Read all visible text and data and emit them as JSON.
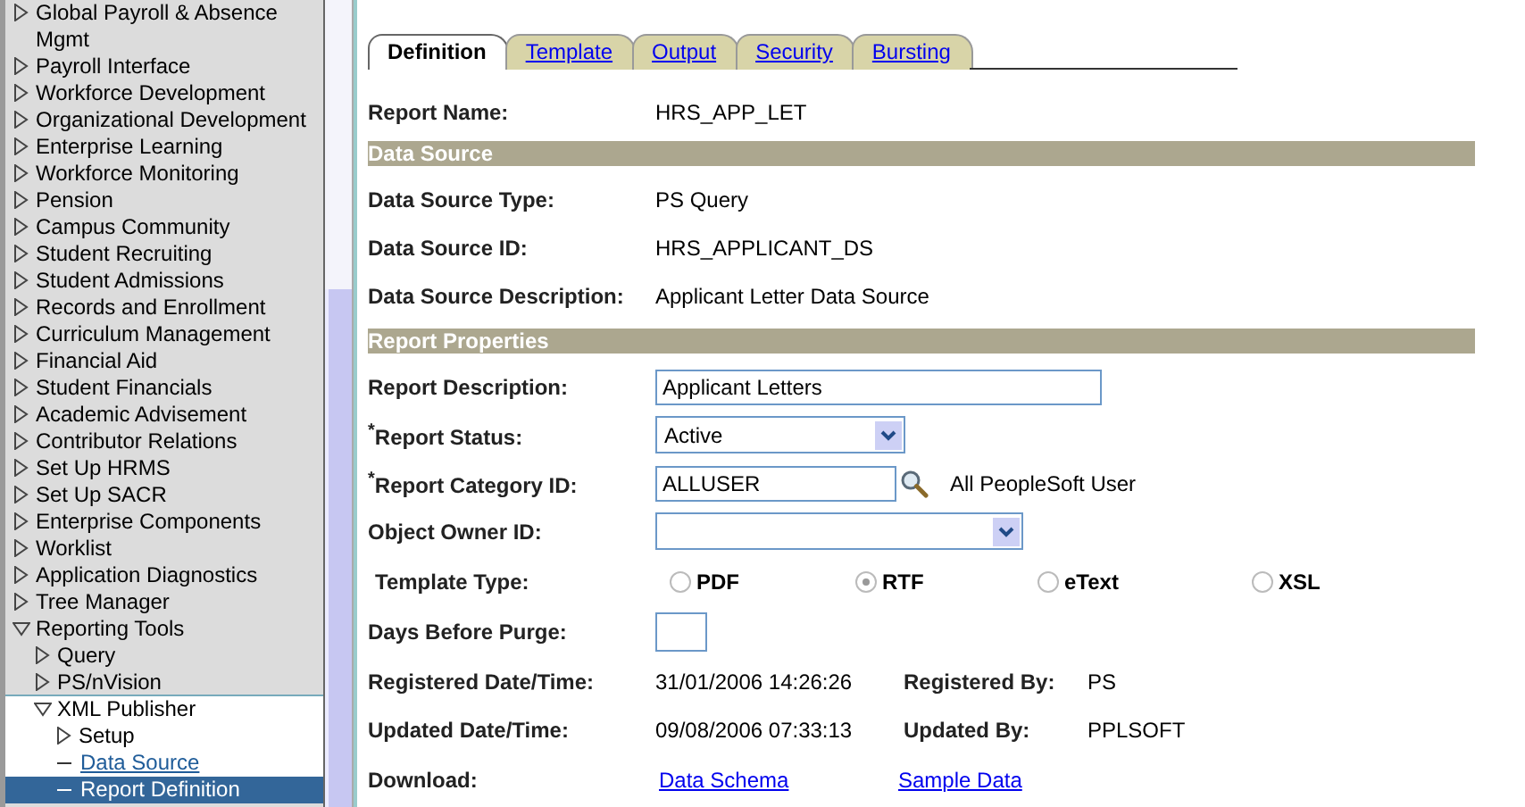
{
  "sidebar": {
    "items": [
      {
        "label": "Global Payroll & Absence Mgmt",
        "kind": "folder",
        "expanded": false
      },
      {
        "label": "Payroll Interface",
        "kind": "folder",
        "expanded": false
      },
      {
        "label": "Workforce Development",
        "kind": "folder",
        "expanded": false
      },
      {
        "label": "Organizational Development",
        "kind": "folder",
        "expanded": false
      },
      {
        "label": "Enterprise Learning",
        "kind": "folder",
        "expanded": false
      },
      {
        "label": "Workforce Monitoring",
        "kind": "folder",
        "expanded": false
      },
      {
        "label": "Pension",
        "kind": "folder",
        "expanded": false
      },
      {
        "label": "Campus Community",
        "kind": "folder",
        "expanded": false
      },
      {
        "label": "Student Recruiting",
        "kind": "folder",
        "expanded": false
      },
      {
        "label": "Student Admissions",
        "kind": "folder",
        "expanded": false
      },
      {
        "label": "Records and Enrollment",
        "kind": "folder",
        "expanded": false
      },
      {
        "label": "Curriculum Management",
        "kind": "folder",
        "expanded": false
      },
      {
        "label": "Financial Aid",
        "kind": "folder",
        "expanded": false
      },
      {
        "label": "Student Financials",
        "kind": "folder",
        "expanded": false
      },
      {
        "label": "Academic Advisement",
        "kind": "folder",
        "expanded": false
      },
      {
        "label": "Contributor Relations",
        "kind": "folder",
        "expanded": false
      },
      {
        "label": "Set Up HRMS",
        "kind": "folder",
        "expanded": false
      },
      {
        "label": "Set Up SACR",
        "kind": "folder",
        "expanded": false
      },
      {
        "label": "Enterprise Components",
        "kind": "folder",
        "expanded": false
      },
      {
        "label": "Worklist",
        "kind": "folder",
        "expanded": false
      },
      {
        "label": "Application Diagnostics",
        "kind": "folder",
        "expanded": false
      },
      {
        "label": "Tree Manager",
        "kind": "folder",
        "expanded": false
      },
      {
        "label": "Reporting Tools",
        "kind": "folder",
        "expanded": true,
        "children": [
          {
            "label": "Query",
            "kind": "folder",
            "expanded": false
          },
          {
            "label": "PS/nVision",
            "kind": "folder",
            "expanded": false
          },
          {
            "label": "XML Publisher",
            "kind": "folder",
            "expanded": true,
            "children": [
              {
                "label": "Setup",
                "kind": "folder",
                "expanded": false
              },
              {
                "label": "Data Source",
                "kind": "link",
                "selected": false
              },
              {
                "label": "Report Definition",
                "kind": "link",
                "selected": true
              }
            ]
          }
        ]
      }
    ]
  },
  "tabs": [
    {
      "label": "Definition",
      "selected": true
    },
    {
      "label": "Template",
      "selected": false
    },
    {
      "label": "Output",
      "selected": false
    },
    {
      "label": "Security",
      "selected": false
    },
    {
      "label": "Bursting",
      "selected": false
    }
  ],
  "report_name": {
    "label": "Report Name:",
    "value": "HRS_APP_LET"
  },
  "data_source": {
    "title": "Data Source",
    "rows": [
      {
        "label": "Data Source Type:",
        "value": "PS Query"
      },
      {
        "label": "Data Source ID:",
        "value": "HRS_APPLICANT_DS"
      },
      {
        "label": "Data Source Description:",
        "value": "Applicant Letter Data Source"
      }
    ]
  },
  "report_properties": {
    "title": "Report Properties",
    "rows": [
      {
        "kind": "input",
        "label": "Report Description:",
        "value": "Applicant Letters"
      },
      {
        "kind": "select",
        "label": "$^{*}$Report Status:",
        "value": "Active"
      },
      {
        "kind": "lookup",
        "label": "$^{*}$Report Category ID:",
        "value": "ALLUSER",
        "description": "All PeopleSoft User"
      },
      {
        "kind": "select-wide",
        "label": "Object Owner ID:"
      },
      {
        "kind": "radios",
        "label": "Template Type:",
        "options": [
          {
            "label": "PDF",
            "selected": false
          },
          {
            "label": "RTF",
            "selected": true
          },
          {
            "label": "eText",
            "selected": false
          },
          {
            "label": "XSL",
            "selected": false
          }
        ]
      },
      {
        "kind": "small-input",
        "label": "Days Before Purge:"
      },
      {
        "kind": "audit",
        "label": "Registered Date/Time:",
        "value": "31/01/2006 14:26:26",
        "by_label": "Registered By:",
        "by_value": "PS"
      },
      {
        "kind": "audit",
        "label": "Updated Date/Time:",
        "value": "09/08/2006 07:33:13",
        "by_label": "Updated By:",
        "by_value": "PPLSOFT"
      },
      {
        "kind": "links",
        "label": "Download:",
        "links": [
          "Data Schema",
          "Sample Data"
        ]
      }
    ]
  }
}
